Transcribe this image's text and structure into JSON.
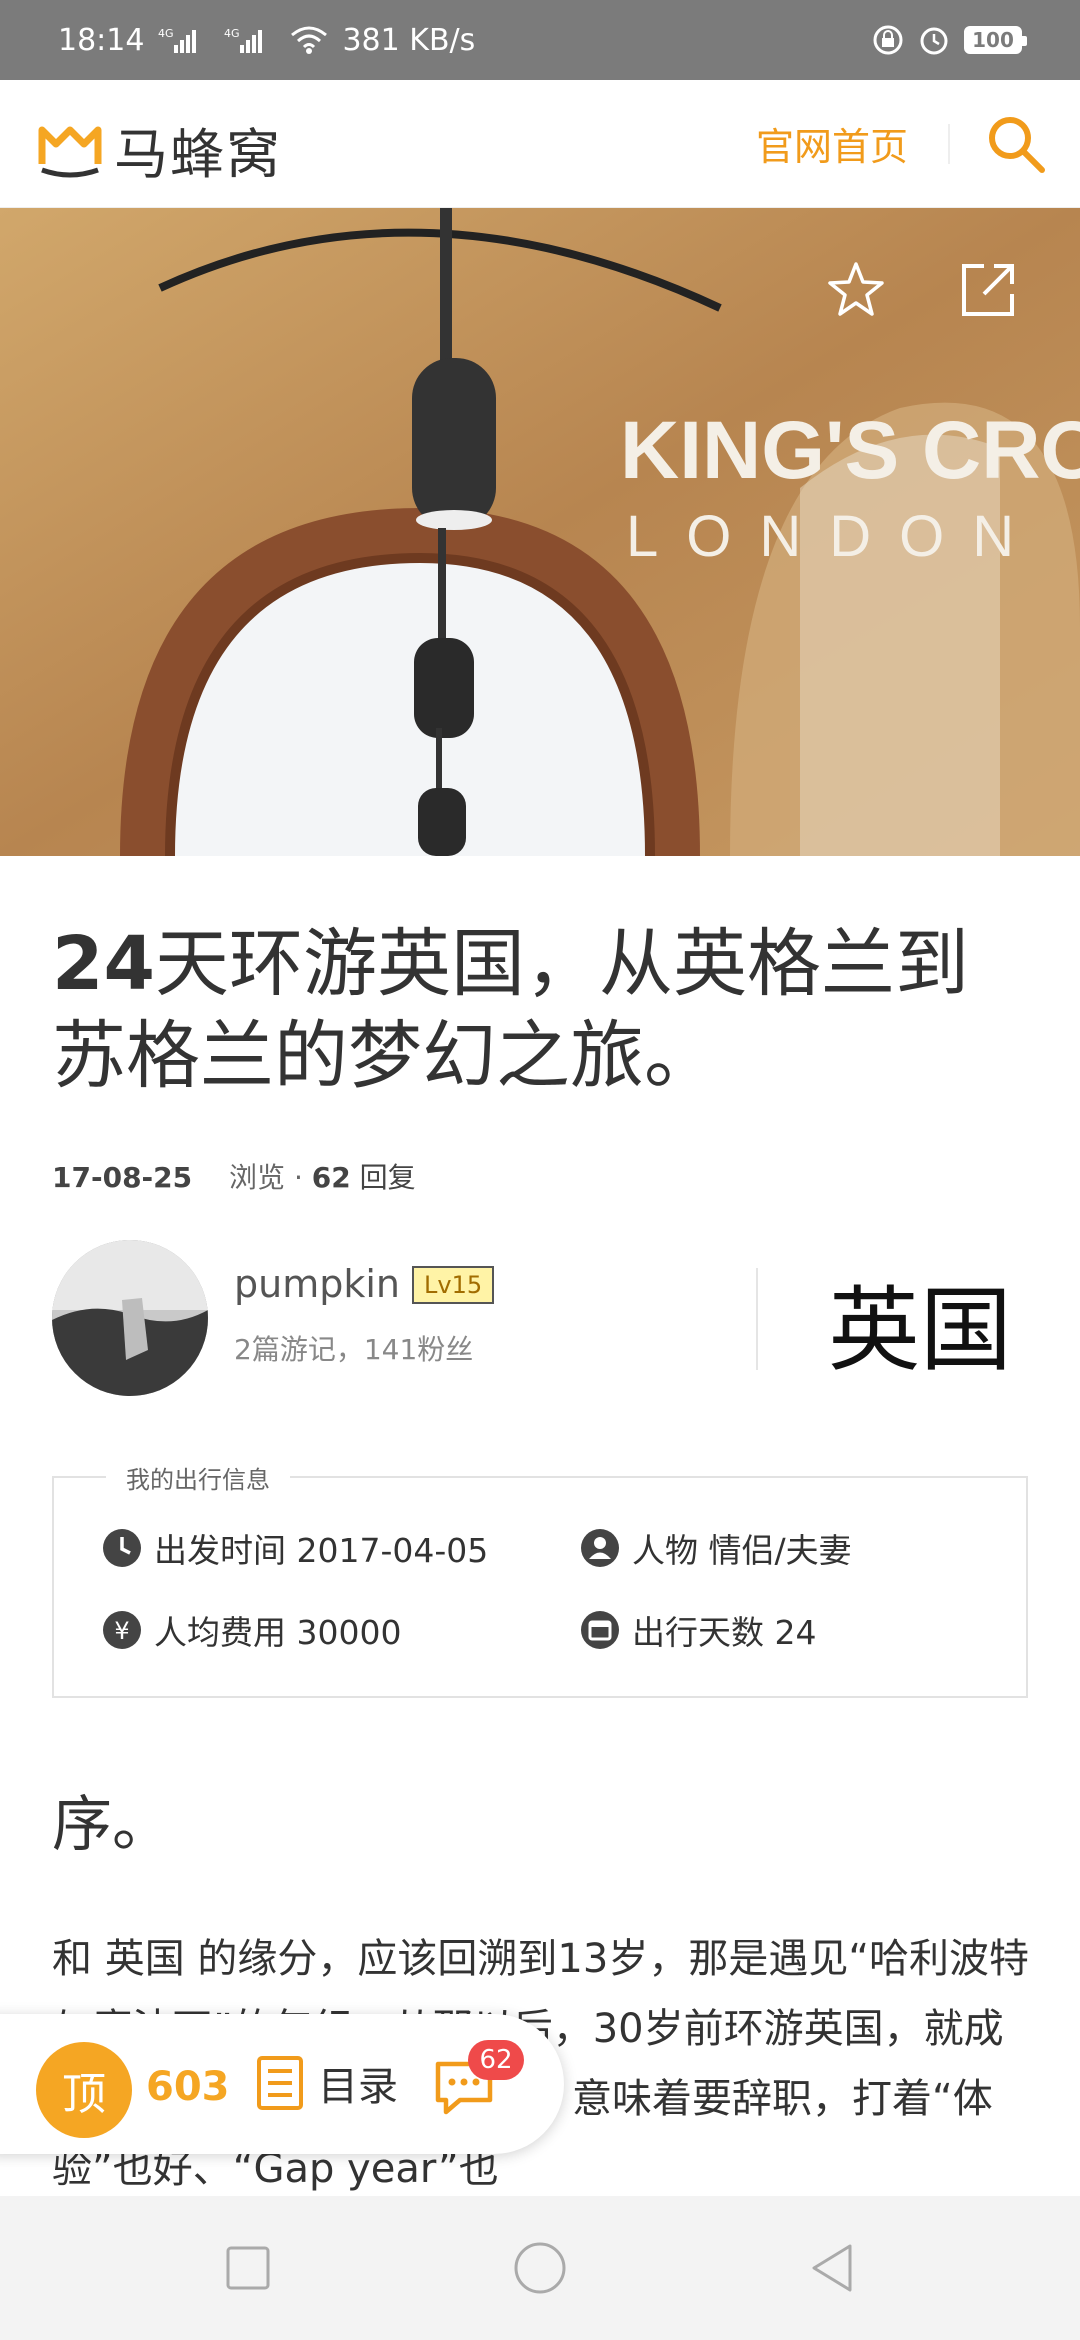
{
  "status_bar": {
    "time": "18:14",
    "network_speed": "381 KB/s",
    "battery": "100",
    "net_label_1": "4G",
    "net_label_2": "4G"
  },
  "header": {
    "app_name": "马蜂窝",
    "home_link": "官网首页"
  },
  "hero": {
    "alt_text_1": "KING'S CROSS",
    "alt_text_2": "LONDON"
  },
  "article": {
    "title_num": "24",
    "title_rest": "天环游英国，从英格兰到苏格兰的梦幻之旅。",
    "date": "17-08-25",
    "views_label": "浏览 · ",
    "reply_count": "62",
    "reply_label": " 回复"
  },
  "author": {
    "name": "pumpkin",
    "level": "Lv15",
    "stats": "2篇游记，141粉丝",
    "country": "英国"
  },
  "trip_info": {
    "legend": "我的出行信息",
    "departure": "出发时间 2017-04-05",
    "people": "人物 情侣/夫妻",
    "cost": "人均费用 30000",
    "days": "出行天数 24"
  },
  "content": {
    "section_title": "序。",
    "paragraph": "和 英国 的缘分，应该回溯到13岁，那是遇见“哈利波特与魔法石”的年纪。从那以后，30岁前环游英国，就成了我的心愿。践行这个心愿，意味着要辞职，打着“体验”也好、“Gap year”也"
  },
  "bottom_bar": {
    "ding_label": "顶",
    "ding_count": "603",
    "toc_label": "目录",
    "comment_badge": "62"
  },
  "colors": {
    "accent": "#f19b1b",
    "ding": "#f5a623",
    "badge": "#ef4a4a"
  }
}
